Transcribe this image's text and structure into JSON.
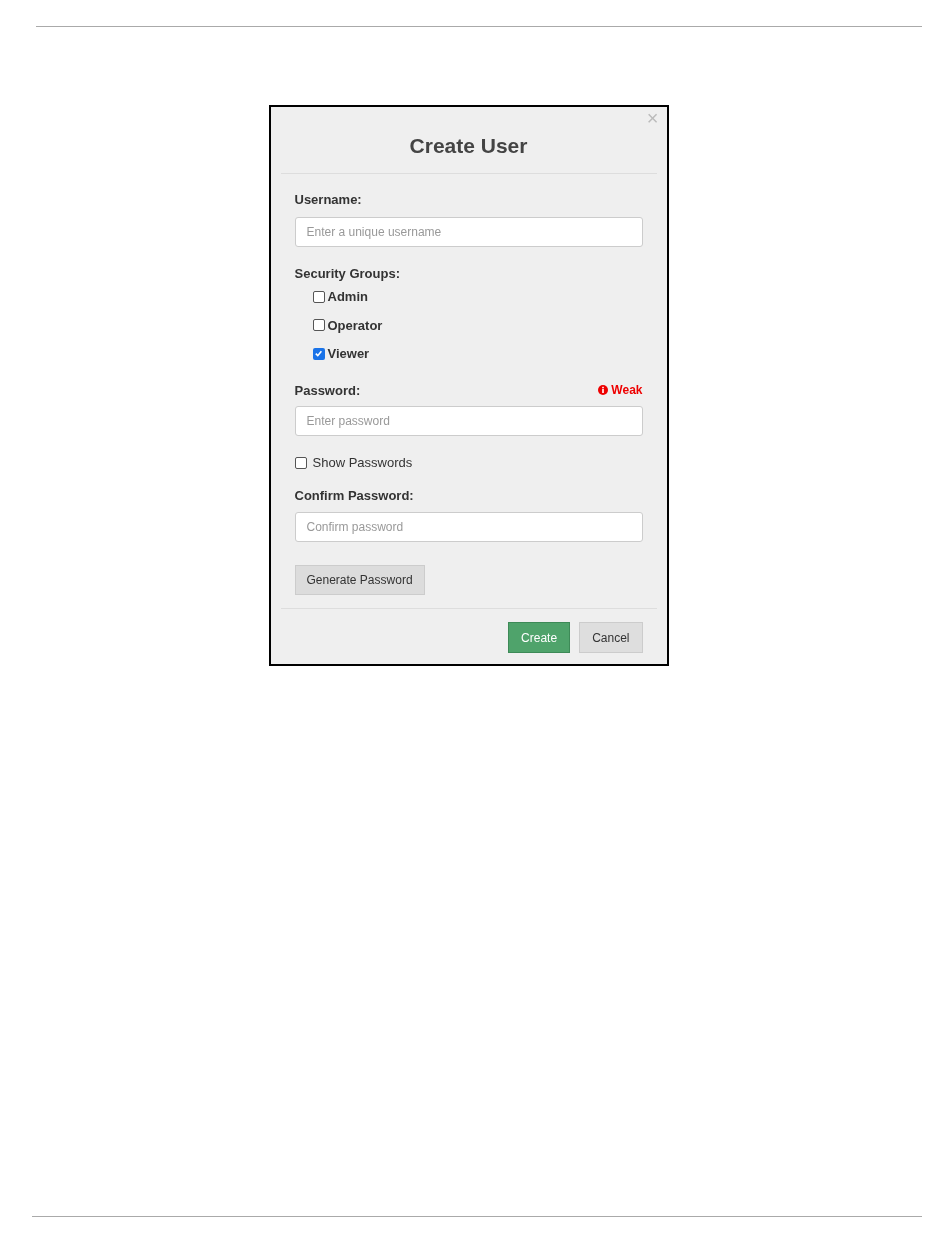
{
  "dialog": {
    "close": "×",
    "title": "Create User",
    "username": {
      "label": "Username:",
      "placeholder": "Enter a unique username"
    },
    "security_groups": {
      "label": "Security Groups:",
      "items": [
        {
          "label": "Admin",
          "checked": false
        },
        {
          "label": "Operator",
          "checked": false
        },
        {
          "label": "Viewer",
          "checked": true
        }
      ]
    },
    "password": {
      "label": "Password:",
      "strength": "Weak",
      "placeholder": "Enter password"
    },
    "show_passwords": {
      "label": "Show Passwords",
      "checked": false
    },
    "confirm_password": {
      "label": "Confirm Password:",
      "placeholder": "Confirm password"
    },
    "generate_button": "Generate Password",
    "buttons": [
      {
        "label": "Create",
        "kind": "primary"
      },
      {
        "label": "Cancel",
        "kind": "secondary"
      }
    ]
  }
}
